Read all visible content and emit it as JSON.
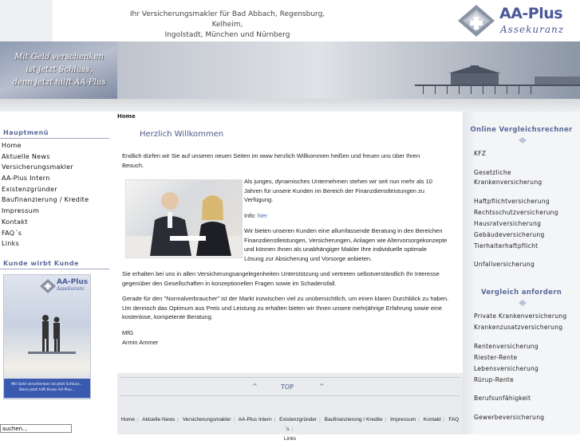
{
  "header": {
    "tagline_line1": "Ihr Versicherungsmakler für Bad Abbach, Regensburg, Kelheim,",
    "tagline_line2": "Ingolstadt, München und Nürnberg",
    "logo_main": "AA-Plus",
    "logo_sub": "Assekuranz"
  },
  "banner": {
    "slogan_line1": "Mit Geld verschenken",
    "slogan_line2": "ist jetzt Schluss,",
    "slogan_line3": "denn jetzt hilft AA-Plus"
  },
  "breadcrumb": "Home",
  "sidebar": {
    "main_heading": "Hauptmenü",
    "items": [
      {
        "label": "Home"
      },
      {
        "label": "Aktuelle News"
      },
      {
        "label": "Versicherungsmakler"
      },
      {
        "label": "AA-Plus Intern"
      },
      {
        "label": "Existenzgründer"
      },
      {
        "label": "Baufinanzierung / Kredite"
      },
      {
        "label": "Impressum"
      },
      {
        "label": "Kontakt"
      },
      {
        "label": "FAQ´s"
      },
      {
        "label": "Links"
      }
    ],
    "referral_heading": "Kunde wirbt Kunde",
    "promo_logo": "AA-Plus",
    "promo_logo_sub": "Assekuranz",
    "promo_caption_line1": "Mit Geld verschenken ist jetzt Schluss...",
    "promo_caption_line2": "Denn jetzt hilft Ihnen AA-Plus...",
    "search_value": "suchen..."
  },
  "main": {
    "welcome": "Herzlich Willkommen",
    "intro": "Endlich dürfen wir Sie auf unseren neuen Seiten im www herzlich Willkommen heißen und freuen uns über Ihren Besuch.",
    "para1": "Als junges, dynamisches Unternehmen stehen wir seit nun mehr als 10 Jahren für unsere Kunden im Bereich der Finanzdienstleistungen zu Verfügung.",
    "info_label": "Info:",
    "info_link": "hier",
    "para2": "Wir bieten unseren Kunden eine allumfassende Beratung in den Bereichen Finanzdienstleistungen, Versicherungen, Anlagen wie Altervorsorgekonzepte und können Ihnen als unabhängiger Makler Ihre individuelle optimale Lösung zur Absicherung und Vorsorge anbieten.",
    "para3": "Sie erhalten bei uns in allen Versicherungsangelegenheiten Unterstützung und vertreten selbstverständlich Ihr Interesse gegenüber den Gesellschaften in konzeptionellen Fragen sowie im Schadensfall.",
    "para4": "Gerade für den \"Normalverbraucher\" ist der Markt inzwischen viel zu unübersichtlich, um einen klaren Durchblick zu haben. Um dennoch das Optimum aus Preis und Leistung zu erhalten bieten wir Ihnen unsere mehrjährige Erfahrung sowie eine kostenlose, kompetente Beratung.",
    "greeting": "MfG",
    "signature": "Armin Ammer",
    "top_arrow": "^",
    "top_label": "TOP"
  },
  "footer": {
    "links": [
      "Home",
      "Aktuelle News",
      "Versicherungsmakler",
      "AA-Plus Intern",
      "Existenzgründer",
      "Baufinanzierung / Kredite",
      "Impressum",
      "Kontakt",
      "FAQ´s"
    ],
    "last_link": "Links"
  },
  "right": {
    "heading1": "Online Vergleichsrechner",
    "group1": [
      "KFZ"
    ],
    "group2": [
      "Gesetzliche",
      "Krankenversicherung"
    ],
    "group3": [
      "Haftpflichtversicherung",
      "Rechtsschutzversicherung",
      "Hausratversicherung",
      "Gebäudeversicherung",
      "Tierhalterhaftpflicht"
    ],
    "group4": [
      "Unfallversicherung"
    ],
    "heading2": "Vergleich anfordern",
    "group5": [
      "Private Krankenversicherung",
      "Krankenzusatzversicherung"
    ],
    "group6": [
      "Rentenversicherung",
      "Riester-Rente",
      "Lebensversicherung",
      "Rürup-Rente"
    ],
    "group7": [
      "Berufsunfähigkeit"
    ],
    "group8": [
      "Gewerbeversicherung"
    ]
  }
}
